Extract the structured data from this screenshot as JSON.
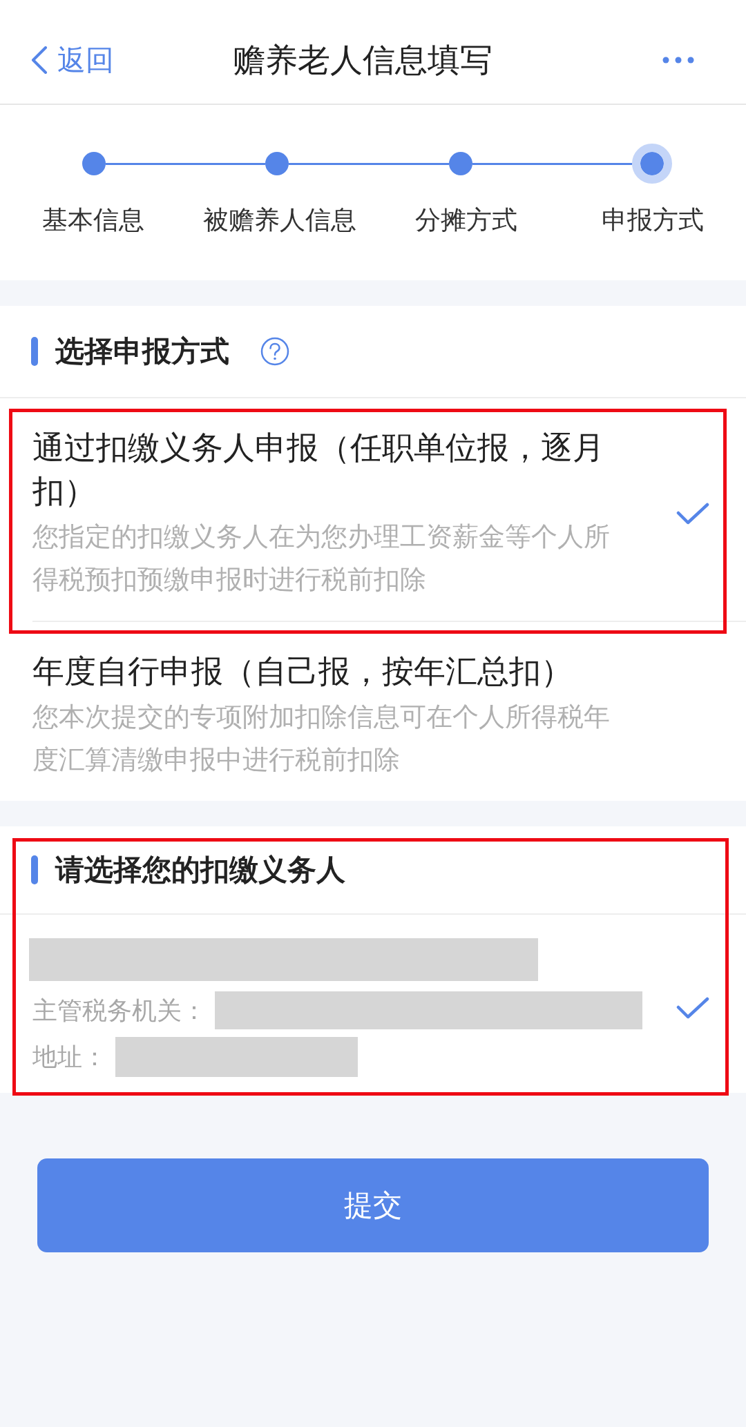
{
  "header": {
    "back_label": "返回",
    "title": "赡养老人信息填写"
  },
  "steps": [
    {
      "label": "基本信息",
      "current": false
    },
    {
      "label": "被赡养人信息",
      "current": false
    },
    {
      "label": "分摊方式",
      "current": false
    },
    {
      "label": "申报方式",
      "current": true
    }
  ],
  "method_section": {
    "title": "选择申报方式",
    "options": [
      {
        "title": "通过扣缴义务人申报（任职单位报，逐月扣）",
        "description": "您指定的扣缴义务人在为您办理工资薪金等个人所得税预扣预缴申报时进行税前扣除",
        "selected": true,
        "highlighted": true
      },
      {
        "title": "年度自行申报（自己报，按年汇总扣）",
        "description": "您本次提交的专项附加扣除信息可在个人所得税年度汇算清缴申报中进行税前扣除",
        "selected": false,
        "highlighted": false
      }
    ]
  },
  "withholder_section": {
    "title": "请选择您的扣缴义务人",
    "highlighted": true,
    "withholders": [
      {
        "name_redacted": true,
        "fields": [
          {
            "label": "主管税务机关：",
            "redacted": true
          },
          {
            "label": "地址：",
            "redacted": true
          }
        ],
        "selected": true
      }
    ]
  },
  "submit_button": {
    "label": "提交"
  }
}
